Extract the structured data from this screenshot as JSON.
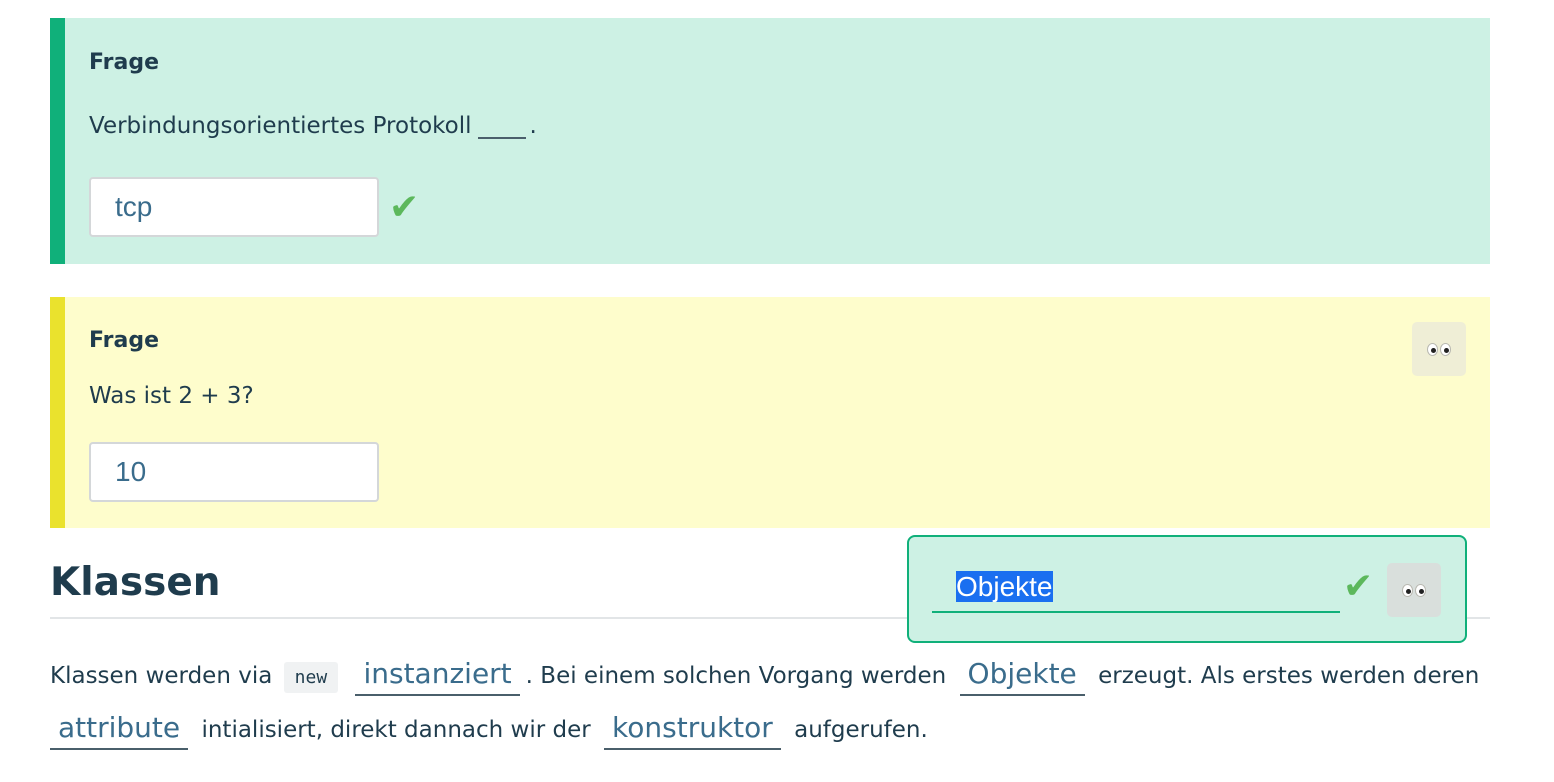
{
  "question1": {
    "title": "Frage",
    "text": "Verbindungsorientiertes Protokoll",
    "after_blank": ".",
    "answer": "tcp",
    "status_icon": "check-icon",
    "status_color": "#5cb85c",
    "check_glyph": "✔"
  },
  "question2": {
    "title": "Frage",
    "text": "Was ist 2 + 3?",
    "answer": "10",
    "reveal_icon": "eyes-icon"
  },
  "section": {
    "heading": "Klassen"
  },
  "popover": {
    "value": "Objekte",
    "check_glyph": "✔",
    "reveal_icon": "eyes-icon"
  },
  "paragraph": {
    "t1": "Klassen werden via",
    "code": "new",
    "gap1": "instanziert",
    "t2": ". Bei einem solchen Vorgang werden",
    "gap2": "Objekte",
    "t3": "erzeugt. Als erstes werden deren",
    "gap3": "attribute",
    "t4": "intialisiert, direkt dannach wir der",
    "gap4": "konstruktor",
    "t5": "aufgerufen."
  },
  "colors": {
    "correct_bg": "#cdf1e4",
    "correct_border": "#10b07a",
    "pending_bg": "#fefdcc",
    "pending_border": "#eae22d",
    "answer_text": "#3a6c8c"
  }
}
